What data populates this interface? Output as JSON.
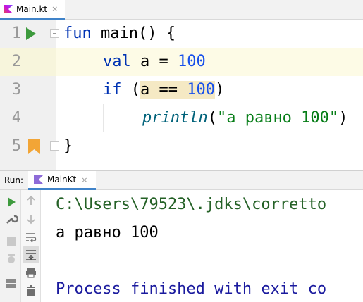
{
  "editor_tab": {
    "label": "Main.kt",
    "close": "×"
  },
  "lines": [
    {
      "num": "1"
    },
    {
      "num": "2"
    },
    {
      "num": "3"
    },
    {
      "num": "4"
    },
    {
      "num": "5"
    }
  ],
  "code": {
    "l1_kw": "fun",
    "l1_rest": " main() {",
    "l2_kw": "val",
    "l2_rest": " a = ",
    "l2_num": "100",
    "l3_kw": "if",
    "l3_open": " (",
    "l3_cond_a": "a == ",
    "l3_cond_num": "100",
    "l3_close": ")",
    "l4_fn": "println",
    "l4_open": "(",
    "l4_str": "\"а равно 100\"",
    "l4_close": ")",
    "l5": "}"
  },
  "run_panel": {
    "label": "Run:",
    "tab_label": "MainKt",
    "tab_close": "×"
  },
  "console": {
    "line1": "C:\\Users\\79523\\.jdks\\corretto",
    "line2": "а равно 100",
    "line3": "Process finished with exit co"
  },
  "colors": {
    "keyword": "#0033b3",
    "number": "#1750eb",
    "string": "#067d17",
    "run_green": "#3d9a3d",
    "bookmark": "#f2a536",
    "console_output_green": "#246126",
    "console_process": "#1a1a9e"
  }
}
